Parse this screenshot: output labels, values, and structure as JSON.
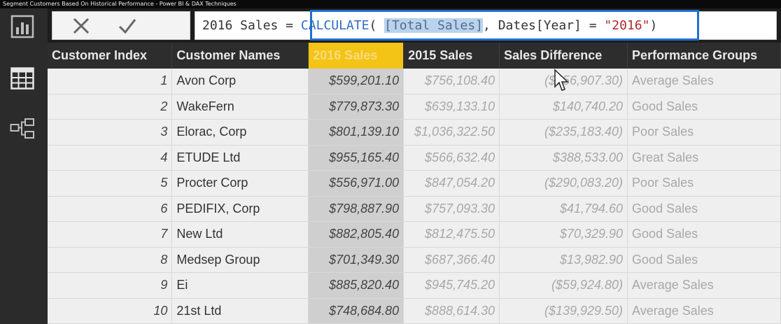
{
  "window": {
    "title": "Segment Customers Based On Historical Performance - Power BI & DAX Techniques"
  },
  "left_rail": {
    "icons": [
      "report-view-icon",
      "data-view-icon",
      "relationships-view-icon"
    ]
  },
  "formula_bar": {
    "measure_name": "2016 Sales",
    "equals": " = ",
    "func": "CALCULATE",
    "open": "( ",
    "ref": "[Total Sales]",
    "middle": ", Dates[Year] = ",
    "string_literal": "\"2016\"",
    "close": ")"
  },
  "table": {
    "columns": [
      "Customer Index",
      "Customer Names",
      "2016 Sales",
      "2015 Sales",
      "Sales Difference",
      "Performance Groups"
    ],
    "rows": [
      [
        "1",
        "Avon Corp",
        "$599,201.10",
        "$756,108.40",
        "($156,907.30)",
        "Average Sales"
      ],
      [
        "2",
        "WakeFern",
        "$779,873.30",
        "$639,133.10",
        "$140,740.20",
        "Good Sales"
      ],
      [
        "3",
        "Elorac, Corp",
        "$801,139.10",
        "$1,036,322.50",
        "($235,183.40)",
        "Poor Sales"
      ],
      [
        "4",
        "ETUDE Ltd",
        "$955,165.40",
        "$566,632.40",
        "$388,533.00",
        "Great Sales"
      ],
      [
        "5",
        "Procter Corp",
        "$556,971.00",
        "$847,054.20",
        "($290,083.20)",
        "Poor Sales"
      ],
      [
        "6",
        "PEDIFIX, Corp",
        "$798,887.90",
        "$757,093.30",
        "$41,794.60",
        "Good Sales"
      ],
      [
        "7",
        "New Ltd",
        "$882,805.40",
        "$812,475.50",
        "$70,329.90",
        "Good Sales"
      ],
      [
        "8",
        "Medsep Group",
        "$701,349.30",
        "$687,366.40",
        "$13,982.90",
        "Good Sales"
      ],
      [
        "9",
        "Ei",
        "$885,820.40",
        "$945,745.20",
        "($59,924.80)",
        "Average Sales"
      ],
      [
        "10",
        "21st Ltd",
        "$748,684.80",
        "$888,614.30",
        "($139,929.50)",
        "Average Sales"
      ]
    ]
  },
  "colors": {
    "highlight_column": "#f3c316",
    "formula_highlight_border": "#1f6fd1",
    "dax_function": "#2f6cc1"
  }
}
